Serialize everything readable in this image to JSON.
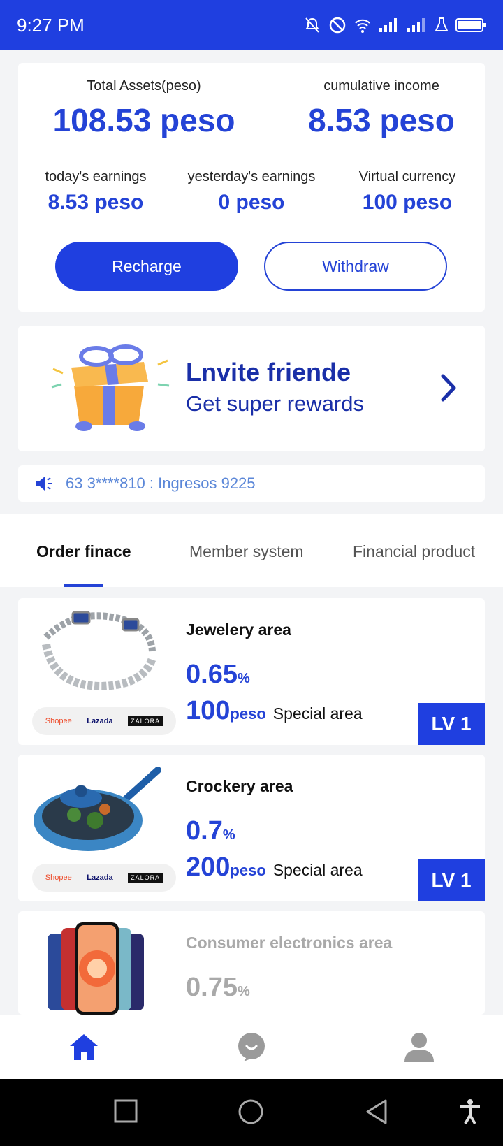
{
  "status_bar": {
    "time": "9:27 PM"
  },
  "assets": {
    "total_label": "Total Assets(peso)",
    "total_value": "108.53 peso",
    "cumulative_label": "cumulative income",
    "cumulative_value": "8.53 peso",
    "today_label": "today's earnings",
    "today_value": "8.53 peso",
    "yesterday_label": "yesterday's earnings",
    "yesterday_value": "0 peso",
    "virtual_label": "Virtual currency",
    "virtual_value": "100 peso",
    "recharge_label": "Recharge",
    "withdraw_label": "Withdraw"
  },
  "invite": {
    "title": "Lnvite friende",
    "subtitle": "Get super rewards"
  },
  "notice": {
    "text": "63 3****810 : Ingresos 9225"
  },
  "tabs": [
    {
      "label": "Order finace",
      "active": true
    },
    {
      "label": "Member system",
      "active": false
    },
    {
      "label": "Financial product",
      "active": false
    }
  ],
  "brands": {
    "shopee": "Shopee",
    "lazada": "Lazada",
    "zalora": "ZALORA"
  },
  "products": [
    {
      "name": "Jewelery area",
      "rate": "0.65",
      "rate_unit": "%",
      "price": "100",
      "price_unit": "peso",
      "area_label": "Special area",
      "level": "LV 1",
      "image": "bracelet"
    },
    {
      "name": "Crockery area",
      "rate": "0.7",
      "rate_unit": "%",
      "price": "200",
      "price_unit": "peso",
      "area_label": "Special area",
      "level": "LV 1",
      "image": "pan"
    },
    {
      "name": "Consumer electronics area",
      "rate": "0.75",
      "rate_unit": "%",
      "image": "phones"
    }
  ],
  "bottom_nav": [
    {
      "name": "home",
      "icon": "home-icon",
      "active": true
    },
    {
      "name": "chat",
      "icon": "chat-icon",
      "active": false
    },
    {
      "name": "profile",
      "icon": "user-icon",
      "active": false
    }
  ],
  "colors": {
    "primary": "#1f3fe0",
    "accent_text": "#2443d6",
    "invite_text": "#1a2fa8",
    "notice_text": "#5b87d8"
  }
}
